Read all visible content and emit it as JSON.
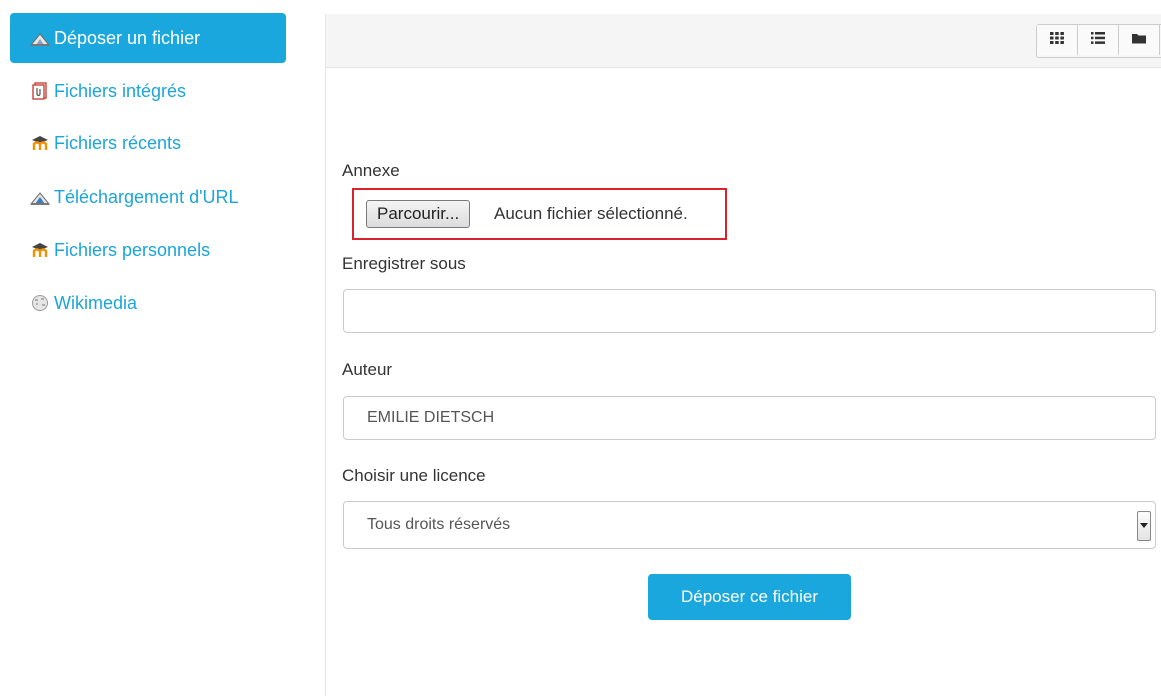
{
  "sidebar": {
    "items": [
      {
        "label": "Déposer un fichier",
        "icon": "upload-icon"
      },
      {
        "label": "Fichiers intégrés",
        "icon": "embedded-files-icon"
      },
      {
        "label": "Fichiers récents",
        "icon": "moodle-icon"
      },
      {
        "label": "Téléchargement d'URL",
        "icon": "url-download-icon"
      },
      {
        "label": "Fichiers personnels",
        "icon": "moodle-icon"
      },
      {
        "label": "Wikimedia",
        "icon": "wikimedia-icon"
      }
    ]
  },
  "toolbar": {
    "views": [
      "grid-view-icon",
      "list-view-icon",
      "folder-view-icon"
    ]
  },
  "form": {
    "attachment_label": "Annexe",
    "browse_label": "Parcourir...",
    "no_file_text": "Aucun fichier sélectionné.",
    "save_as_label": "Enregistrer sous",
    "save_as_value": "",
    "author_label": "Auteur",
    "author_value": "EMILIE DIETSCH",
    "license_label": "Choisir une licence",
    "license_value": "Tous droits réservés",
    "submit_label": "Déposer ce fichier"
  },
  "colors": {
    "accent": "#19a7de",
    "link": "#1ba5d8",
    "highlight_border": "#d8232a"
  }
}
